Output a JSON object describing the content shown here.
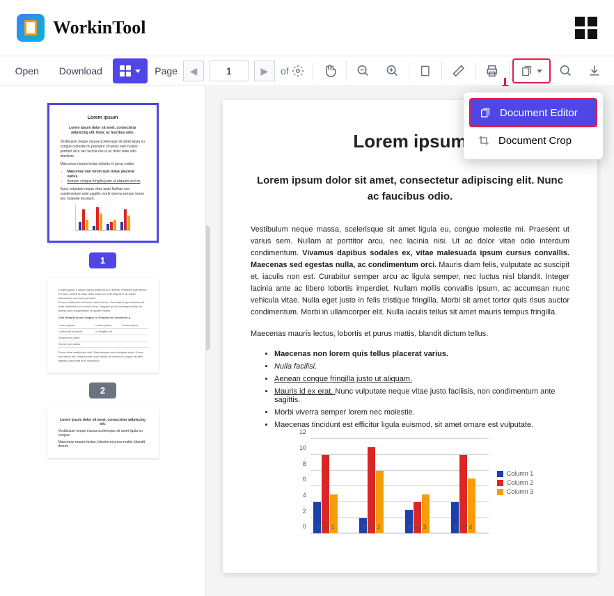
{
  "brand": {
    "name": "WorkinTool"
  },
  "toolbar": {
    "open": "Open",
    "download": "Download",
    "page_label": "Page",
    "page_value": "1",
    "of": "of"
  },
  "sidebar": {
    "pages": [
      1,
      2
    ]
  },
  "dropdown": {
    "editor": "Document Editor",
    "crop": "Document Crop"
  },
  "doc": {
    "title": "Lorem ipsum",
    "lead": "Lorem ipsum dolor sit amet, consectetur adipiscing elit. Nunc ac faucibus odio.",
    "para1_a": "Vestibulum neque massa, scelerisque sit amet ligula eu, congue molestie mi. Praesent ut varius sem. Nullam at porttitor arcu, nec lacinia nisi. Ut ac dolor vitae odio interdum condimentum. ",
    "para1_b": "Vivamus dapibus sodales ex, vitae malesuada ipsum cursus convallis. Maecenas sed egestas nulla, ac condimentum orci.",
    "para1_c": " Mauris diam felis, vulputate ac suscipit et, iaculis non est. Curabitur semper arcu ac ligula semper, nec luctus nisl blandit. Integer lacinia ante ac libero lobortis imperdiet. Nullam mollis convallis ipsum, ac accumsan nunc vehicula vitae. Nulla eget justo in felis tristique fringilla. Morbi sit amet tortor quis risus auctor condimentum. Morbi in ullamcorper elit. Nulla iaculis tellus sit amet mauris tempus fringilla.",
    "para2": "Maecenas mauris lectus, lobortis et purus mattis, blandit dictum tellus.",
    "list": {
      "i1": "Maecenas non lorem quis tellus placerat varius.",
      "i2": "Nulla facilisi.",
      "i3": "Aenean congue fringilla justo ut aliquam.",
      "i4a": "Mauris id ex erat. ",
      "i4b": "Nunc vulputate neque vitae justo facilisis, non condimentum ante sagittis.",
      "i5": "Morbi viverra semper lorem nec molestie.",
      "i6": "Maecenas tincidunt est efficitur ligula euismod, sit amet ornare est vulputate."
    }
  },
  "chart_data": {
    "type": "bar",
    "categories": [
      "Row 1",
      "Row 2",
      "Row 3",
      "Row 4"
    ],
    "series": [
      {
        "name": "Column 1",
        "color": "#1e40af",
        "values": [
          4,
          2,
          3,
          4
        ]
      },
      {
        "name": "Column 2",
        "color": "#dc2626",
        "values": [
          10,
          11,
          4,
          10
        ]
      },
      {
        "name": "Column 3",
        "color": "#f59e0b",
        "values": [
          5,
          8,
          5,
          7
        ]
      }
    ],
    "ylim": [
      0,
      12
    ],
    "yticks": [
      0,
      2,
      4,
      6,
      8,
      10,
      12
    ]
  },
  "legend": {
    "c1": "Column 1",
    "c2": "Column 2",
    "c3": "Column 3"
  }
}
